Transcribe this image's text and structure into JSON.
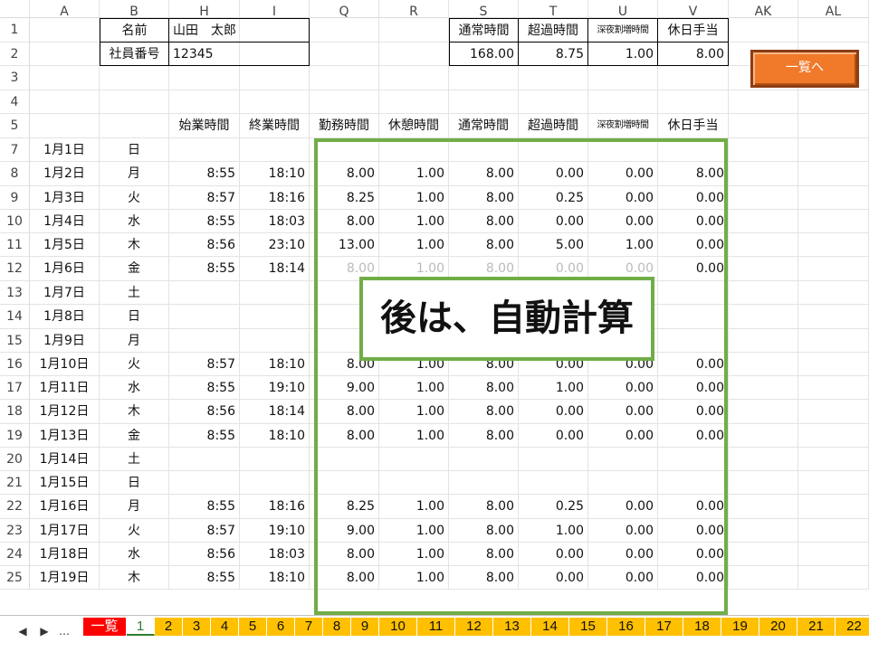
{
  "columns": [
    "A",
    "B",
    "H",
    "I",
    "Q",
    "R",
    "S",
    "T",
    "U",
    "V",
    "AK",
    "AL"
  ],
  "rows": [
    "1",
    "2",
    "3",
    "4",
    "5",
    "7",
    "8",
    "9",
    "10",
    "11",
    "12",
    "13",
    "14",
    "15",
    "16",
    "17",
    "18",
    "19",
    "20",
    "21",
    "22",
    "23",
    "24",
    "25"
  ],
  "header_info": {
    "name_label": "名前",
    "name_value": "山田　太郎",
    "id_label": "社員番号",
    "id_value": "12345",
    "summary_labels": [
      "通常時間",
      "超過時間",
      "深夜割増時間",
      "休日手当"
    ],
    "summary_values": [
      "168.00",
      "8.75",
      "1.00",
      "8.00"
    ]
  },
  "table_headers": [
    "始業時間",
    "終業時間",
    "勤務時間",
    "休憩時間",
    "通常時間",
    "超過時間",
    "深夜割増時間",
    "休日手当"
  ],
  "days": [
    {
      "date": "1月1日",
      "dow": "日",
      "start": "",
      "end": "",
      "work": "",
      "rest": "",
      "normal": "",
      "over": "",
      "night": "",
      "holiday": ""
    },
    {
      "date": "1月2日",
      "dow": "月",
      "start": "8:55",
      "end": "18:10",
      "work": "8.00",
      "rest": "1.00",
      "normal": "8.00",
      "over": "0.00",
      "night": "0.00",
      "holiday": "8.00"
    },
    {
      "date": "1月3日",
      "dow": "火",
      "start": "8:57",
      "end": "18:16",
      "work": "8.25",
      "rest": "1.00",
      "normal": "8.00",
      "over": "0.25",
      "night": "0.00",
      "holiday": "0.00"
    },
    {
      "date": "1月4日",
      "dow": "水",
      "start": "8:55",
      "end": "18:03",
      "work": "8.00",
      "rest": "1.00",
      "normal": "8.00",
      "over": "0.00",
      "night": "0.00",
      "holiday": "0.00"
    },
    {
      "date": "1月5日",
      "dow": "木",
      "start": "8:56",
      "end": "23:10",
      "work": "13.00",
      "rest": "1.00",
      "normal": "8.00",
      "over": "5.00",
      "night": "1.00",
      "holiday": "0.00"
    },
    {
      "date": "1月6日",
      "dow": "金",
      "start": "8:55",
      "end": "18:14",
      "work": "8.00",
      "rest": "1.00",
      "normal": "8.00",
      "over": "0.00",
      "night": "0.00",
      "holiday": "0.00"
    },
    {
      "date": "1月7日",
      "dow": "土",
      "start": "",
      "end": "",
      "work": "",
      "rest": "",
      "normal": "",
      "over": "",
      "night": "",
      "holiday": ""
    },
    {
      "date": "1月8日",
      "dow": "日",
      "start": "",
      "end": "",
      "work": "",
      "rest": "",
      "normal": "",
      "over": "",
      "night": "",
      "holiday": ""
    },
    {
      "date": "1月9日",
      "dow": "月",
      "start": "",
      "end": "",
      "work": "",
      "rest": "",
      "normal": "",
      "over": "",
      "night": "",
      "holiday": ""
    },
    {
      "date": "1月10日",
      "dow": "火",
      "start": "8:57",
      "end": "18:10",
      "work": "8.00",
      "rest": "1.00",
      "normal": "8.00",
      "over": "0.00",
      "night": "0.00",
      "holiday": "0.00"
    },
    {
      "date": "1月11日",
      "dow": "水",
      "start": "8:55",
      "end": "19:10",
      "work": "9.00",
      "rest": "1.00",
      "normal": "8.00",
      "over": "1.00",
      "night": "0.00",
      "holiday": "0.00"
    },
    {
      "date": "1月12日",
      "dow": "木",
      "start": "8:56",
      "end": "18:14",
      "work": "8.00",
      "rest": "1.00",
      "normal": "8.00",
      "over": "0.00",
      "night": "0.00",
      "holiday": "0.00"
    },
    {
      "date": "1月13日",
      "dow": "金",
      "start": "8:55",
      "end": "18:10",
      "work": "8.00",
      "rest": "1.00",
      "normal": "8.00",
      "over": "0.00",
      "night": "0.00",
      "holiday": "0.00"
    },
    {
      "date": "1月14日",
      "dow": "土",
      "start": "",
      "end": "",
      "work": "",
      "rest": "",
      "normal": "",
      "over": "",
      "night": "",
      "holiday": ""
    },
    {
      "date": "1月15日",
      "dow": "日",
      "start": "",
      "end": "",
      "work": "",
      "rest": "",
      "normal": "",
      "over": "",
      "night": "",
      "holiday": ""
    },
    {
      "date": "1月16日",
      "dow": "月",
      "start": "8:55",
      "end": "18:16",
      "work": "8.25",
      "rest": "1.00",
      "normal": "8.00",
      "over": "0.25",
      "night": "0.00",
      "holiday": "0.00"
    },
    {
      "date": "1月17日",
      "dow": "火",
      "start": "8:57",
      "end": "19:10",
      "work": "9.00",
      "rest": "1.00",
      "normal": "8.00",
      "over": "1.00",
      "night": "0.00",
      "holiday": "0.00"
    },
    {
      "date": "1月18日",
      "dow": "水",
      "start": "8:56",
      "end": "18:03",
      "work": "8.00",
      "rest": "1.00",
      "normal": "8.00",
      "over": "0.00",
      "night": "0.00",
      "holiday": "0.00"
    },
    {
      "date": "1月19日",
      "dow": "木",
      "start": "8:55",
      "end": "18:10",
      "work": "8.00",
      "rest": "1.00",
      "normal": "8.00",
      "over": "0.00",
      "night": "0.00",
      "holiday": "0.00"
    }
  ],
  "button_label": "一覧へ",
  "callout_text": "後は、自動計算",
  "sheet_nav": [
    "◀",
    "▶",
    "…"
  ],
  "sheet_tabs": [
    "一覧",
    "1",
    "2",
    "3",
    "4",
    "5",
    "6",
    "7",
    "8",
    "9",
    "10",
    "11",
    "12",
    "13",
    "14",
    "15",
    "16",
    "17",
    "18",
    "19",
    "20",
    "21",
    "22"
  ],
  "active_tab": "1",
  "colors": {
    "accent_green": "#70ad47",
    "button_orange": "#f07a2a",
    "tab_yellow": "#ffc000",
    "tab_red": "#ff0000"
  }
}
